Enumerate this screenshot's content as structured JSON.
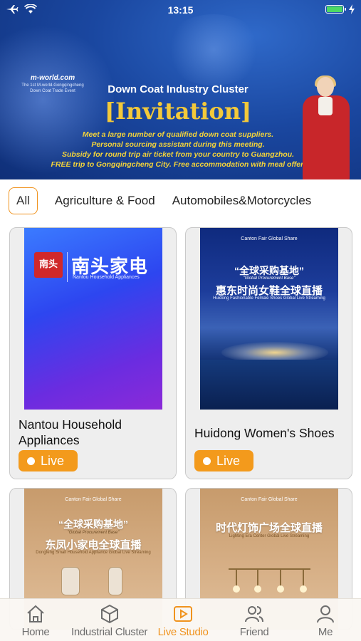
{
  "status_bar": {
    "time": "13:15",
    "icons": [
      "airplane-icon",
      "wifi-icon",
      "battery-icon",
      "charging-icon"
    ],
    "battery_color": "#4cd964"
  },
  "banner": {
    "logo_text": "m-world.com",
    "logo_caption": "The 1st M-world-Gongqingcheng Down Coat Trade Event",
    "title": "Down Coat Industry Cluster",
    "headline": "[Invitation]",
    "lines": [
      "Meet a large number of qualified down coat suppliers.",
      "Personal sourcing assistant during this meeting.",
      "Subsidy for round trip air ticket from your country to Guangzhou.",
      "FREE trip to Gongqingcheng City. Free accommodation with meal offer."
    ]
  },
  "tabs": {
    "items": [
      {
        "label": "All",
        "active": true
      },
      {
        "label": "Agriculture & Food",
        "active": false
      },
      {
        "label": "Automobiles&Motorcycles",
        "active": false
      }
    ]
  },
  "cards": [
    {
      "title": "Nantou Household Appliances",
      "live_label": "Live",
      "image": {
        "logo": "南头",
        "brand_cn": "南头家电",
        "brand_en": "Nantou Household Appliances"
      }
    },
    {
      "title": "Huidong Women's Shoes",
      "live_label": "Live",
      "image": {
        "logos": "Canton Fair  Global Share",
        "quote": "“全球采购基地”",
        "sub": "\"Global Procurement Base\"",
        "big": "惠东时尚女鞋全球直播",
        "en": "Huidong Fashionable Female Shoes Global Live Streaming"
      }
    },
    {
      "title": "",
      "image": {
        "logos": "Canton Fair  Global Share",
        "quote": "“全球采购基地”",
        "sub": "\"Global Procurement Base\"",
        "big": "东凤小家电全球直播",
        "en": "Dongfeng Small Household Appliance Global Live Streaming"
      }
    },
    {
      "title": "",
      "image": {
        "logos": "Canton Fair  Global Share",
        "big": "时代灯饰广场全球直播",
        "en": "Lighting Era Center Global Live Streaming"
      }
    }
  ],
  "bottom_nav": {
    "items": [
      {
        "label": "Home",
        "icon": "home-icon",
        "active": false
      },
      {
        "label": "Industrial Cluster",
        "icon": "cube-icon",
        "active": false
      },
      {
        "label": "Live Studio",
        "icon": "play-icon",
        "active": true
      },
      {
        "label": "Friend",
        "icon": "friends-icon",
        "active": false
      },
      {
        "label": "Me",
        "icon": "person-icon",
        "active": false
      }
    ],
    "active_color": "#f0931e",
    "inactive_color": "#6d6d6d"
  }
}
